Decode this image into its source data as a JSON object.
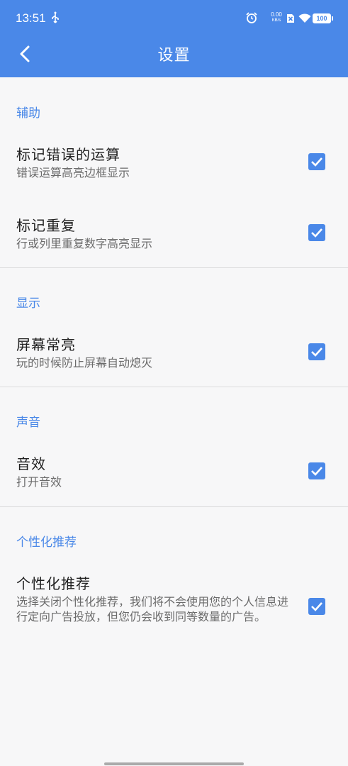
{
  "status_bar": {
    "time": "13:51",
    "net_speed_value": "0.00",
    "net_speed_unit": "KB/s",
    "battery": "100"
  },
  "header": {
    "title": "设置"
  },
  "sections": [
    {
      "header": "辅助",
      "items": [
        {
          "title": "标记错误的运算",
          "desc": "错误运算高亮边框显示",
          "checked": true
        },
        {
          "title": "标记重复",
          "desc": "行或列里重复数字高亮显示",
          "checked": true
        }
      ]
    },
    {
      "header": "显示",
      "items": [
        {
          "title": "屏幕常亮",
          "desc": "玩的时候防止屏幕自动熄灭",
          "checked": true
        }
      ]
    },
    {
      "header": "声音",
      "items": [
        {
          "title": "音效",
          "desc": "打开音效",
          "checked": true
        }
      ]
    },
    {
      "header": "个性化推荐",
      "items": [
        {
          "title": "个性化推荐",
          "desc": "选择关闭个性化推荐，我们将不会使用您的个人信息进行定向广告投放，但您仍会收到同等数量的广告。",
          "checked": true
        }
      ]
    }
  ],
  "colors": {
    "accent": "#4a88e8",
    "background": "#f7f7f8",
    "divider": "#dcdcdc"
  }
}
